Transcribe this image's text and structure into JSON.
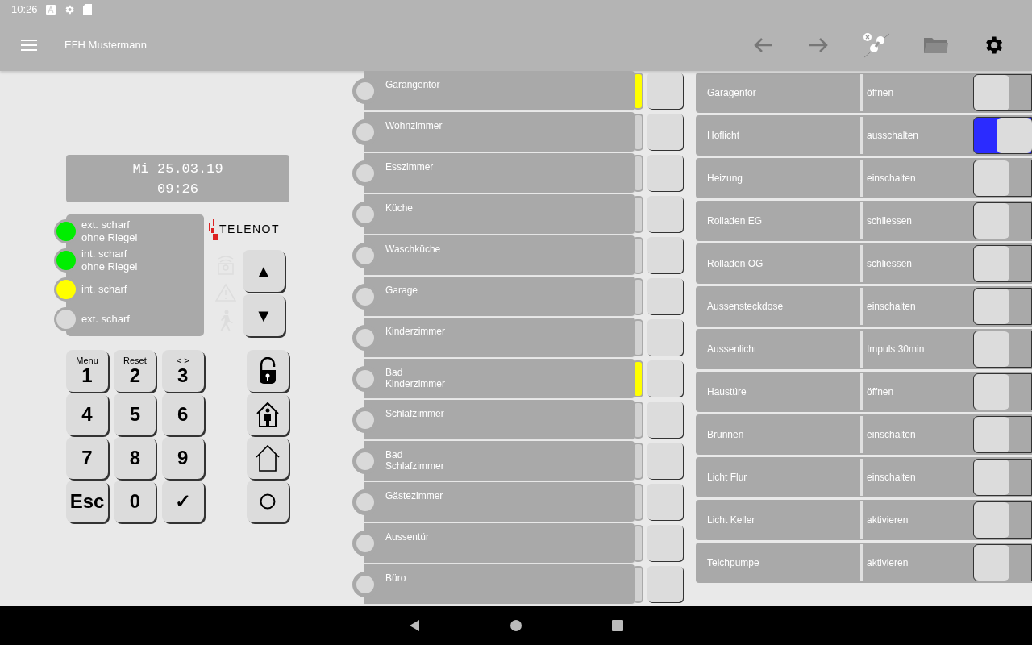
{
  "status_bar": {
    "time": "10:26"
  },
  "app_bar": {
    "title": "EFH Mustermann"
  },
  "display": {
    "line_1": "Mi 25.03.19",
    "line_2": "09:26"
  },
  "leds": [
    {
      "label": "ext. scharf\nohne Riegel",
      "color": "#00ee00"
    },
    {
      "label": "int. scharf\nohne Riegel",
      "color": "#00ee00"
    },
    {
      "label": "int. scharf",
      "color": "#ffff00"
    },
    {
      "label": "ext. scharf",
      "color": "#d9d9d9"
    }
  ],
  "logo": {
    "text": "TELENOT"
  },
  "arrow_keys": [
    "▲",
    "▼"
  ],
  "keypad": [
    {
      "label": "1",
      "sublabel": "Menu"
    },
    {
      "label": "2",
      "sublabel": "Reset"
    },
    {
      "label": "3",
      "sublabel": "< >"
    },
    {
      "label": "4"
    },
    {
      "label": "5"
    },
    {
      "label": "6"
    },
    {
      "label": "7"
    },
    {
      "label": "8"
    },
    {
      "label": "9"
    },
    {
      "label": "Esc"
    },
    {
      "label": "0"
    },
    {
      "label": "✓"
    }
  ],
  "mode_keys": [
    {
      "kind": "unlock"
    },
    {
      "kind": "internal"
    },
    {
      "kind": "external"
    },
    {
      "kind": "off"
    }
  ],
  "zones": [
    {
      "name": "Garangentor",
      "alert": true
    },
    {
      "name": "Wohnzimmer",
      "alert": false
    },
    {
      "name": "Esszimmer",
      "alert": false
    },
    {
      "name": "Küche",
      "alert": false
    },
    {
      "name": "Waschküche",
      "alert": false
    },
    {
      "name": "Garage",
      "alert": false
    },
    {
      "name": "Kinderzimmer",
      "alert": false
    },
    {
      "name": "Bad\nKinderzimmer",
      "alert": true
    },
    {
      "name": "Schlafzimmer",
      "alert": false
    },
    {
      "name": "Bad\nSchlafzimmer",
      "alert": false
    },
    {
      "name": "Gästezimmer",
      "alert": false
    },
    {
      "name": "Aussentür",
      "alert": false
    },
    {
      "name": "Büro",
      "alert": false
    }
  ],
  "switches": [
    {
      "name": "Garagentor",
      "action": "öffnen",
      "on": false
    },
    {
      "name": "Hoflicht",
      "action": "ausschalten",
      "on": true
    },
    {
      "name": "Heizung",
      "action": "einschalten",
      "on": false
    },
    {
      "name": "Rolladen EG",
      "action": "schliessen",
      "on": false
    },
    {
      "name": "Rolladen OG",
      "action": "schliessen",
      "on": false
    },
    {
      "name": "Aussensteckdose",
      "action": "einschalten",
      "on": false
    },
    {
      "name": "Aussenlicht",
      "action": "Impuls 30min",
      "on": false
    },
    {
      "name": "Haustüre",
      "action": "öffnen",
      "on": false
    },
    {
      "name": "Brunnen",
      "action": "einschalten",
      "on": false
    },
    {
      "name": "Licht Flur",
      "action": "einschalten",
      "on": false
    },
    {
      "name": "Licht Keller",
      "action": "aktivieren",
      "on": false
    },
    {
      "name": "Teichpumpe",
      "action": "aktivieren",
      "on": false
    }
  ]
}
